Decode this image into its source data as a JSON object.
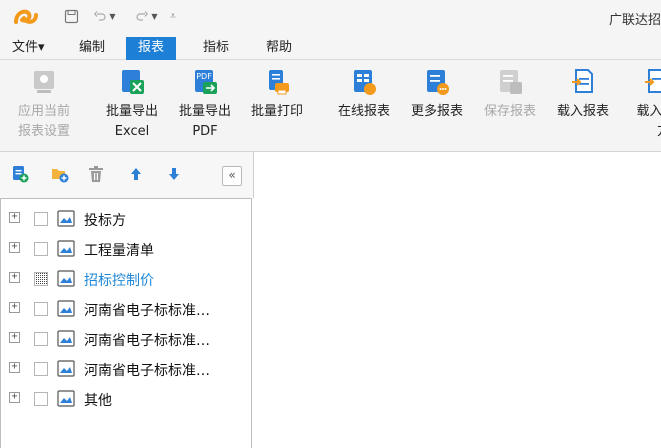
{
  "app": {
    "title": "广联达招"
  },
  "menu": [
    {
      "label": "文件▾",
      "active": false
    },
    {
      "label": "编制",
      "active": false
    },
    {
      "label": "报表",
      "active": true
    },
    {
      "label": "指标",
      "active": false
    },
    {
      "label": "帮助",
      "active": false
    }
  ],
  "ribbon": [
    {
      "l1": "应用当前",
      "l2": "报表设置",
      "icon": "apply-settings-icon",
      "disabled": true
    },
    {
      "l1": "批量导出",
      "l2": "Excel",
      "icon": "excel-export-icon",
      "disabled": false
    },
    {
      "l1": "批量导出",
      "l2": "PDF",
      "icon": "pdf-export-icon",
      "disabled": false
    },
    {
      "l1": "批量打印",
      "l2": "",
      "icon": "print-icon",
      "disabled": false
    },
    {
      "l1": "在线报表",
      "l2": "",
      "icon": "online-report-icon",
      "disabled": false
    },
    {
      "l1": "更多报表",
      "l2": "",
      "icon": "more-reports-icon",
      "disabled": false
    },
    {
      "l1": "保存报表",
      "l2": "",
      "icon": "save-report-icon",
      "disabled": true
    },
    {
      "l1": "载入报表",
      "l2": "",
      "icon": "load-report-icon",
      "disabled": false
    },
    {
      "l1": "载入报",
      "l2": "方案",
      "icon": "load-scheme-icon",
      "disabled": false
    }
  ],
  "tree": {
    "collapse_label": "«",
    "items": [
      {
        "label": "投标方",
        "selected": false,
        "checked": "none"
      },
      {
        "label": "工程量清单",
        "selected": false,
        "checked": "none"
      },
      {
        "label": "招标控制价",
        "selected": true,
        "checked": "partial"
      },
      {
        "label": "河南省电子标标准…",
        "selected": false,
        "checked": "none"
      },
      {
        "label": "河南省电子标标准…",
        "selected": false,
        "checked": "none"
      },
      {
        "label": "河南省电子标标准…",
        "selected": false,
        "checked": "none"
      },
      {
        "label": "其他",
        "selected": false,
        "checked": "none"
      }
    ]
  },
  "colors": {
    "accent": "#1e7fd6",
    "selected_text": "#1e88d8",
    "excel_green": "#1aa15a",
    "icon_blue": "#2d7fd8"
  }
}
